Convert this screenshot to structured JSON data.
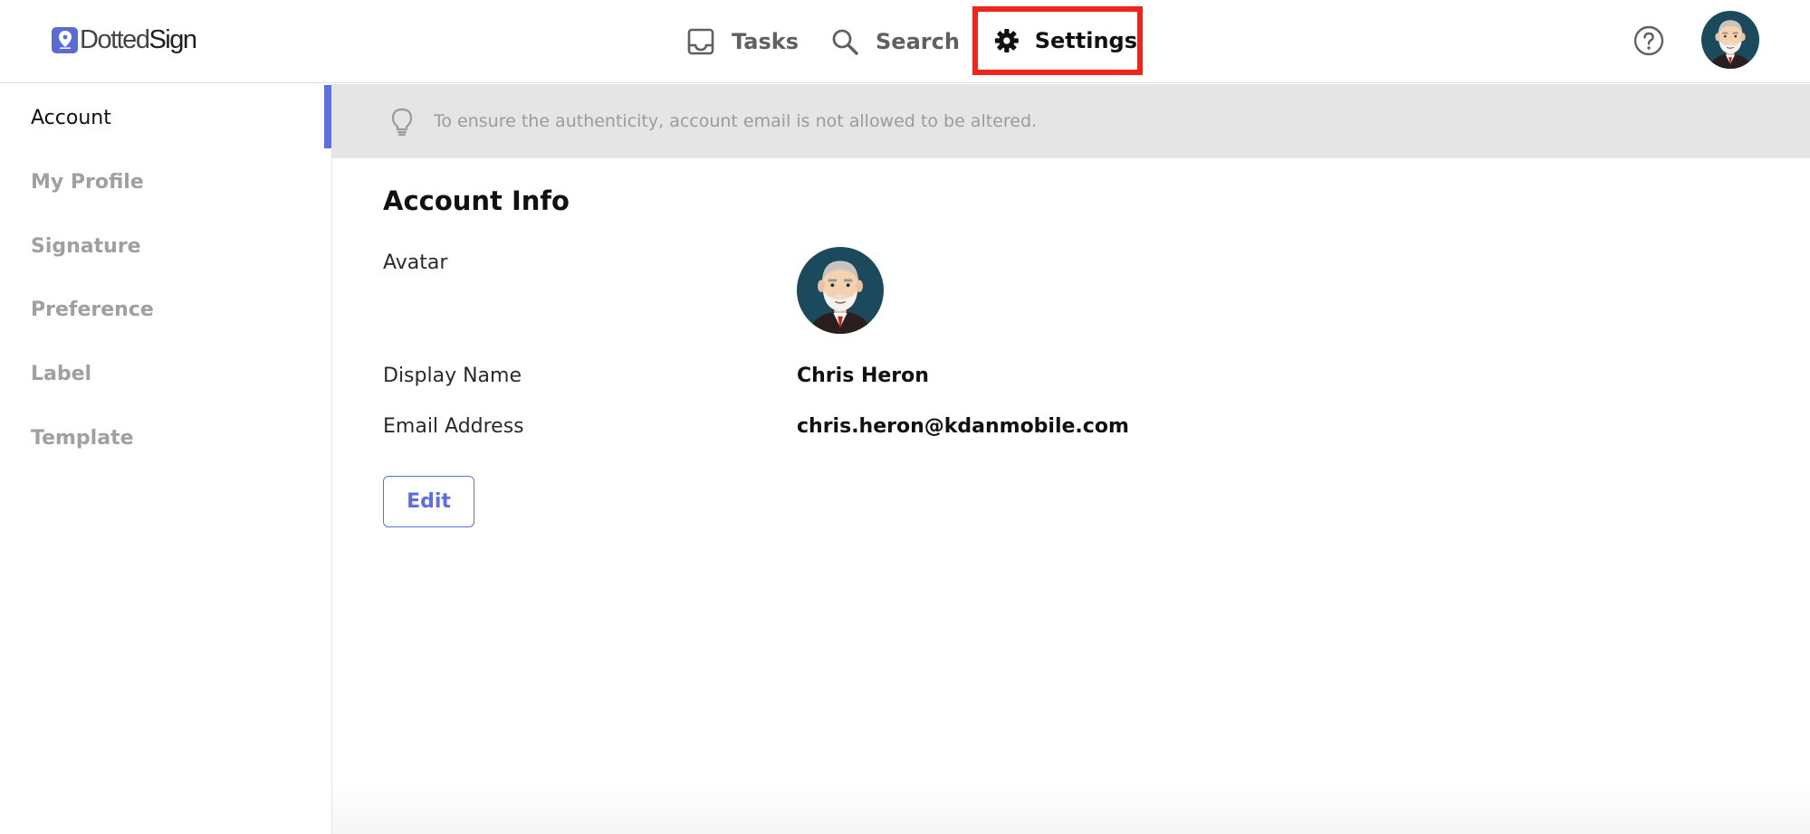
{
  "app": {
    "logo_prefix": "Dotted",
    "logo_suffix": "Sign"
  },
  "nav": {
    "tasks": {
      "label": "Tasks",
      "icon": "inbox-icon"
    },
    "search": {
      "label": "Search",
      "icon": "search-icon"
    },
    "settings": {
      "label": "Settings",
      "icon": "gear-icon",
      "active": true
    }
  },
  "header_icons": {
    "help": "help-icon",
    "avatar": "user-avatar"
  },
  "sidebar": {
    "items": [
      {
        "label": "Account",
        "active": true
      },
      {
        "label": "My Profile",
        "active": false
      },
      {
        "label": "Signature",
        "active": false
      },
      {
        "label": "Preference",
        "active": false
      },
      {
        "label": "Label",
        "active": false
      },
      {
        "label": "Template",
        "active": false
      }
    ]
  },
  "notice": {
    "icon": "lightbulb-icon",
    "text": "To ensure the authenticity, account email is not allowed to be altered."
  },
  "account_info": {
    "title": "Account Info",
    "avatar_label": "Avatar",
    "display_name_label": "Display Name",
    "display_name": "Chris Heron",
    "email_label": "Email Address",
    "email": "chris.heron@kdanmobile.com",
    "edit_label": "Edit"
  },
  "colors": {
    "accent": "#5e6ee3",
    "highlight_box": "#f1241c",
    "banner_bg": "#e5e5e5"
  }
}
